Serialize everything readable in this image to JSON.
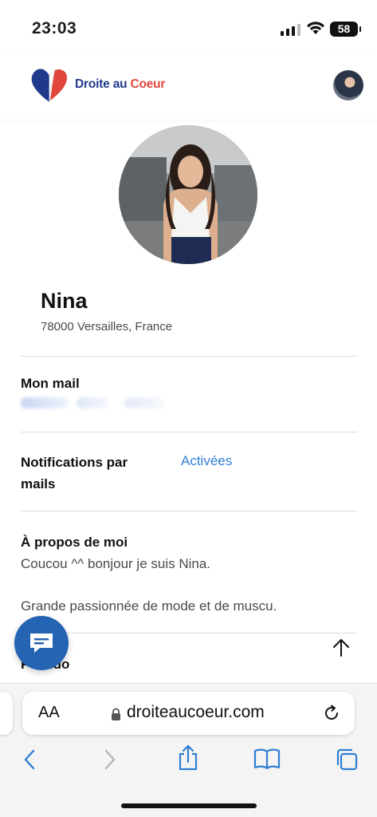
{
  "status_bar": {
    "time": "23:03",
    "battery": "58"
  },
  "header": {
    "logo_text_part1": "Droite au ",
    "logo_text_part2": "Coeur",
    "colors": {
      "blue": "#1f3a8a",
      "red": "#e0463c"
    }
  },
  "profile": {
    "name": "Nina",
    "location": "78000 Versailles, France"
  },
  "sections": {
    "mail_label": "Mon mail",
    "notifications_label_line1": "Notifications par",
    "notifications_label_line2": "mails",
    "notifications_value": "Activées",
    "about_label": "À propos de moi",
    "about_line1": "Coucou ^^ bonjour je suis Nina.",
    "about_line2": "Grande passionnée de mode et de muscu.",
    "pseudo_label": "Pseudo"
  },
  "browser": {
    "aa_label": "AA",
    "url": "droiteaucoeur.com"
  },
  "icons": {
    "chat": "chat-bubble-icon",
    "scroll_top": "arrow-up-icon",
    "back": "chevron-left-icon",
    "forward": "chevron-right-icon",
    "share": "share-icon",
    "bookmarks": "book-icon",
    "tabs": "tabs-icon"
  }
}
